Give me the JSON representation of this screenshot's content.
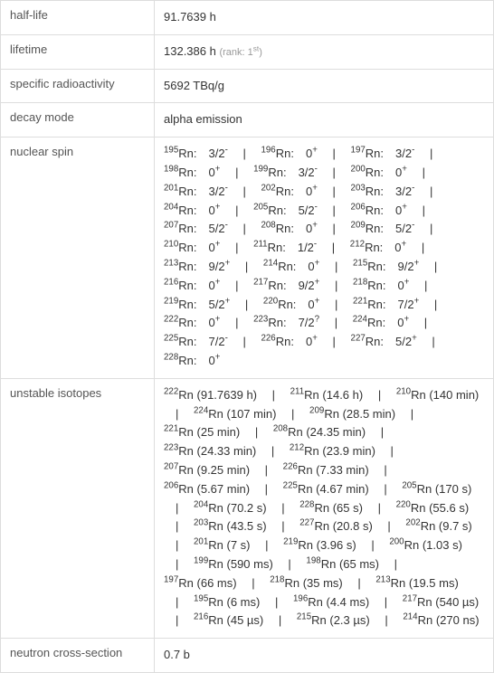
{
  "rows": {
    "halflife": {
      "label": "half-life",
      "value": "91.7639 h"
    },
    "lifetime": {
      "label": "lifetime",
      "value": "132.386 h",
      "rank": "(rank: 1",
      "rank_sup": "st",
      "rank_close": ")"
    },
    "specific_radioactivity": {
      "label": "specific radioactivity",
      "value": "5692 TBq/g"
    },
    "decay_mode": {
      "label": "decay mode",
      "value": "alpha emission"
    },
    "nuclear_spin": {
      "label": "nuclear spin"
    },
    "unstable_isotopes": {
      "label": "unstable isotopes"
    },
    "neutron_cross_section": {
      "label": "neutron cross-section",
      "value": "0.7 b"
    }
  },
  "nuclear_spins": [
    {
      "mass": "195",
      "el": "Rn",
      "spin": "3/2",
      "sign": "-"
    },
    {
      "mass": "196",
      "el": "Rn",
      "spin": "0",
      "sign": "+"
    },
    {
      "mass": "197",
      "el": "Rn",
      "spin": "3/2",
      "sign": "-"
    },
    {
      "mass": "198",
      "el": "Rn",
      "spin": "0",
      "sign": "+"
    },
    {
      "mass": "199",
      "el": "Rn",
      "spin": "3/2",
      "sign": "-"
    },
    {
      "mass": "200",
      "el": "Rn",
      "spin": "0",
      "sign": "+"
    },
    {
      "mass": "201",
      "el": "Rn",
      "spin": "3/2",
      "sign": "-"
    },
    {
      "mass": "202",
      "el": "Rn",
      "spin": "0",
      "sign": "+"
    },
    {
      "mass": "203",
      "el": "Rn",
      "spin": "3/2",
      "sign": "-"
    },
    {
      "mass": "204",
      "el": "Rn",
      "spin": "0",
      "sign": "+"
    },
    {
      "mass": "205",
      "el": "Rn",
      "spin": "5/2",
      "sign": "-"
    },
    {
      "mass": "206",
      "el": "Rn",
      "spin": "0",
      "sign": "+"
    },
    {
      "mass": "207",
      "el": "Rn",
      "spin": "5/2",
      "sign": "-"
    },
    {
      "mass": "208",
      "el": "Rn",
      "spin": "0",
      "sign": "+"
    },
    {
      "mass": "209",
      "el": "Rn",
      "spin": "5/2",
      "sign": "-"
    },
    {
      "mass": "210",
      "el": "Rn",
      "spin": "0",
      "sign": "+"
    },
    {
      "mass": "211",
      "el": "Rn",
      "spin": "1/2",
      "sign": "-"
    },
    {
      "mass": "212",
      "el": "Rn",
      "spin": "0",
      "sign": "+"
    },
    {
      "mass": "213",
      "el": "Rn",
      "spin": "9/2",
      "sign": "+"
    },
    {
      "mass": "214",
      "el": "Rn",
      "spin": "0",
      "sign": "+"
    },
    {
      "mass": "215",
      "el": "Rn",
      "spin": "9/2",
      "sign": "+"
    },
    {
      "mass": "216",
      "el": "Rn",
      "spin": "0",
      "sign": "+"
    },
    {
      "mass": "217",
      "el": "Rn",
      "spin": "9/2",
      "sign": "+"
    },
    {
      "mass": "218",
      "el": "Rn",
      "spin": "0",
      "sign": "+"
    },
    {
      "mass": "219",
      "el": "Rn",
      "spin": "5/2",
      "sign": "+"
    },
    {
      "mass": "220",
      "el": "Rn",
      "spin": "0",
      "sign": "+"
    },
    {
      "mass": "221",
      "el": "Rn",
      "spin": "7/2",
      "sign": "+"
    },
    {
      "mass": "222",
      "el": "Rn",
      "spin": "0",
      "sign": "+"
    },
    {
      "mass": "223",
      "el": "Rn",
      "spin": "7/2",
      "sign": "?"
    },
    {
      "mass": "224",
      "el": "Rn",
      "spin": "0",
      "sign": "+"
    },
    {
      "mass": "225",
      "el": "Rn",
      "spin": "7/2",
      "sign": "-"
    },
    {
      "mass": "226",
      "el": "Rn",
      "spin": "0",
      "sign": "+"
    },
    {
      "mass": "227",
      "el": "Rn",
      "spin": "5/2",
      "sign": "+"
    },
    {
      "mass": "228",
      "el": "Rn",
      "spin": "0",
      "sign": "+"
    }
  ],
  "unstable_isotopes": [
    {
      "mass": "222",
      "el": "Rn",
      "half": "(91.7639 h)"
    },
    {
      "mass": "211",
      "el": "Rn",
      "half": "(14.6 h)"
    },
    {
      "mass": "210",
      "el": "Rn",
      "half": "(140 min)"
    },
    {
      "mass": "224",
      "el": "Rn",
      "half": "(107 min)"
    },
    {
      "mass": "209",
      "el": "Rn",
      "half": "(28.5 min)"
    },
    {
      "mass": "221",
      "el": "Rn",
      "half": "(25 min)"
    },
    {
      "mass": "208",
      "el": "Rn",
      "half": "(24.35 min)"
    },
    {
      "mass": "223",
      "el": "Rn",
      "half": "(24.33 min)"
    },
    {
      "mass": "212",
      "el": "Rn",
      "half": "(23.9 min)"
    },
    {
      "mass": "207",
      "el": "Rn",
      "half": "(9.25 min)"
    },
    {
      "mass": "226",
      "el": "Rn",
      "half": "(7.33 min)"
    },
    {
      "mass": "206",
      "el": "Rn",
      "half": "(5.67 min)"
    },
    {
      "mass": "225",
      "el": "Rn",
      "half": "(4.67 min)"
    },
    {
      "mass": "205",
      "el": "Rn",
      "half": "(170 s)"
    },
    {
      "mass": "204",
      "el": "Rn",
      "half": "(70.2 s)"
    },
    {
      "mass": "228",
      "el": "Rn",
      "half": "(65 s)"
    },
    {
      "mass": "220",
      "el": "Rn",
      "half": "(55.6 s)"
    },
    {
      "mass": "203",
      "el": "Rn",
      "half": "(43.5 s)"
    },
    {
      "mass": "227",
      "el": "Rn",
      "half": "(20.8 s)"
    },
    {
      "mass": "202",
      "el": "Rn",
      "half": "(9.7 s)"
    },
    {
      "mass": "201",
      "el": "Rn",
      "half": "(7 s)"
    },
    {
      "mass": "219",
      "el": "Rn",
      "half": "(3.96 s)"
    },
    {
      "mass": "200",
      "el": "Rn",
      "half": "(1.03 s)"
    },
    {
      "mass": "199",
      "el": "Rn",
      "half": "(590 ms)"
    },
    {
      "mass": "198",
      "el": "Rn",
      "half": "(65 ms)"
    },
    {
      "mass": "197",
      "el": "Rn",
      "half": "(66 ms)"
    },
    {
      "mass": "218",
      "el": "Rn",
      "half": "(35 ms)"
    },
    {
      "mass": "213",
      "el": "Rn",
      "half": "(19.5 ms)"
    },
    {
      "mass": "195",
      "el": "Rn",
      "half": "(6 ms)"
    },
    {
      "mass": "196",
      "el": "Rn",
      "half": "(4.4 ms)"
    },
    {
      "mass": "217",
      "el": "Rn",
      "half": "(540 µs)"
    },
    {
      "mass": "216",
      "el": "Rn",
      "half": "(45 µs)"
    },
    {
      "mass": "215",
      "el": "Rn",
      "half": "(2.3 µs)"
    },
    {
      "mass": "214",
      "el": "Rn",
      "half": "(270 ns)"
    }
  ]
}
